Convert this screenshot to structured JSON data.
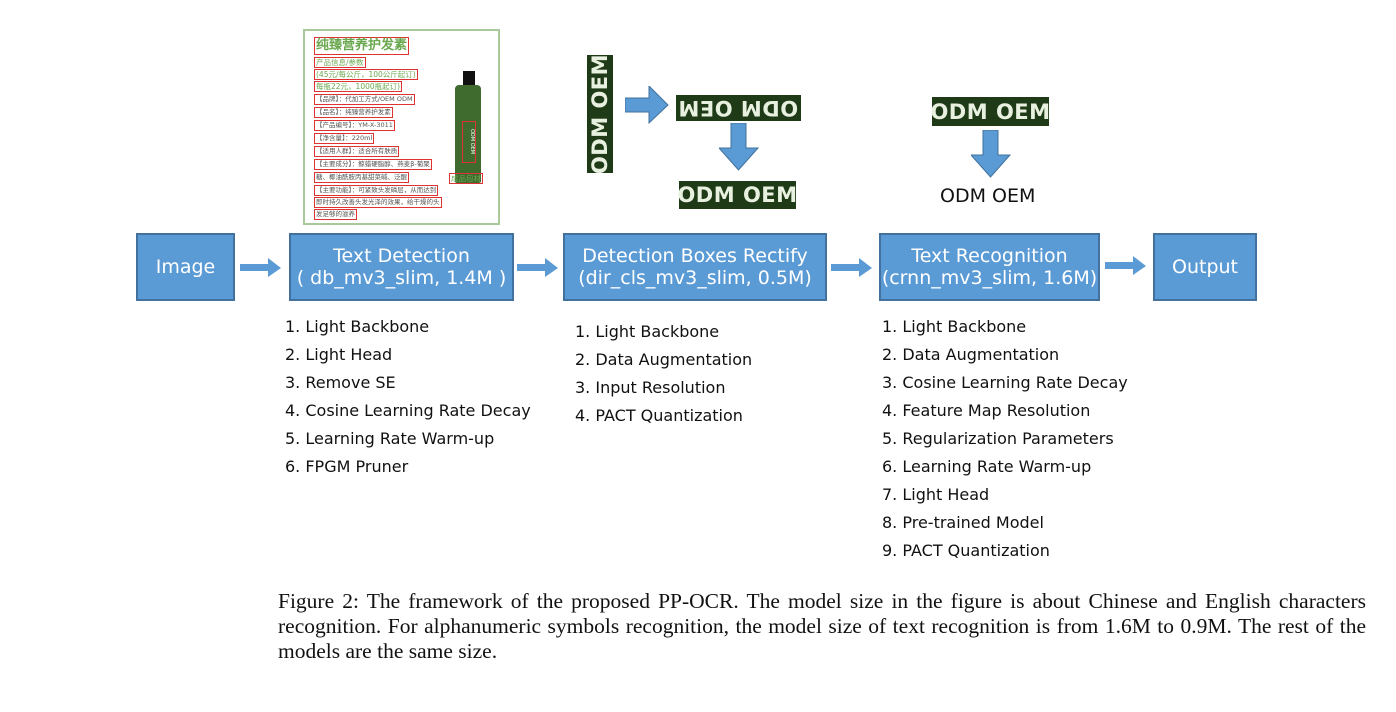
{
  "product_image": {
    "lines": [
      "纯臻营养护发素",
      "产品信息/参数",
      "(45元/每公斤，100公斤起订)",
      "每瓶22元，1000瓶起订)",
      "【品牌】：代加工方式/OEM ODM",
      "【品名】：纯臻营养护发素",
      "【产品编号】：YM-X-3011",
      "【净含量】：220ml",
      "【适用人群】：适合所有肤质",
      "【主要成分】：鲸蜡硬脂醇、燕麦β-葡聚",
      "糖、椰油酰胺丙基甜菜碱、泛醌",
      "【主要功能】：可紧致头发磷层，从而达到",
      "即时持久改善头发光泽的效果，给干燥的头",
      "发足够的滋养"
    ],
    "bottle_label": "ODM OEM",
    "package_label": "成品包材"
  },
  "crops": {
    "vertical": "ODM OEM",
    "flipped": "ODM OEM",
    "rectified": "ODM OEM",
    "recognition_input": "ODM OEM",
    "recognition_output": "ODM OEM"
  },
  "pipeline": {
    "image": "Image",
    "detection": {
      "title": "Text Detection",
      "subtitle": "( db_mv3_slim, 1.4M )"
    },
    "rectify": {
      "title": "Detection Boxes Rectify",
      "subtitle": "(dir_cls_mv3_slim, 0.5M)"
    },
    "recognition": {
      "title": "Text Recognition",
      "subtitle": "(crnn_mv3_slim, 1.6M)"
    },
    "output": "Output"
  },
  "detection_list": [
    "1.  Light Backbone",
    "2.  Light Head",
    "3.  Remove SE",
    "4.  Cosine Learning Rate Decay",
    "5.  Learning Rate Warm-up",
    "6.  FPGM Pruner"
  ],
  "rectify_list": [
    "1.  Light Backbone",
    "2.  Data Augmentation",
    "3.  Input Resolution",
    "4.  PACT Quantization"
  ],
  "recognition_list": [
    "1.  Light Backbone",
    "2.  Data Augmentation",
    "3.  Cosine Learning Rate Decay",
    "4.  Feature Map Resolution",
    "5.  Regularization Parameters",
    "6.  Learning Rate Warm-up",
    "7.  Light Head",
    "8.  Pre-trained Model",
    "9.  PACT Quantization"
  ],
  "caption": {
    "lines": [
      "Figure 2: The framework of the proposed PP-OCR. The model size in the figure is about Chinese and English characters",
      "recognition. For alphanumeric symbols recognition, the model size of text recognition is from 1.6M to 0.9M. The rest of the",
      "models are the same size."
    ]
  },
  "colors": {
    "box_fill": "#5b9bd5",
    "box_border": "#41719c",
    "arrow": "#5b9bd5",
    "crop_bg": "#1f3a16"
  }
}
